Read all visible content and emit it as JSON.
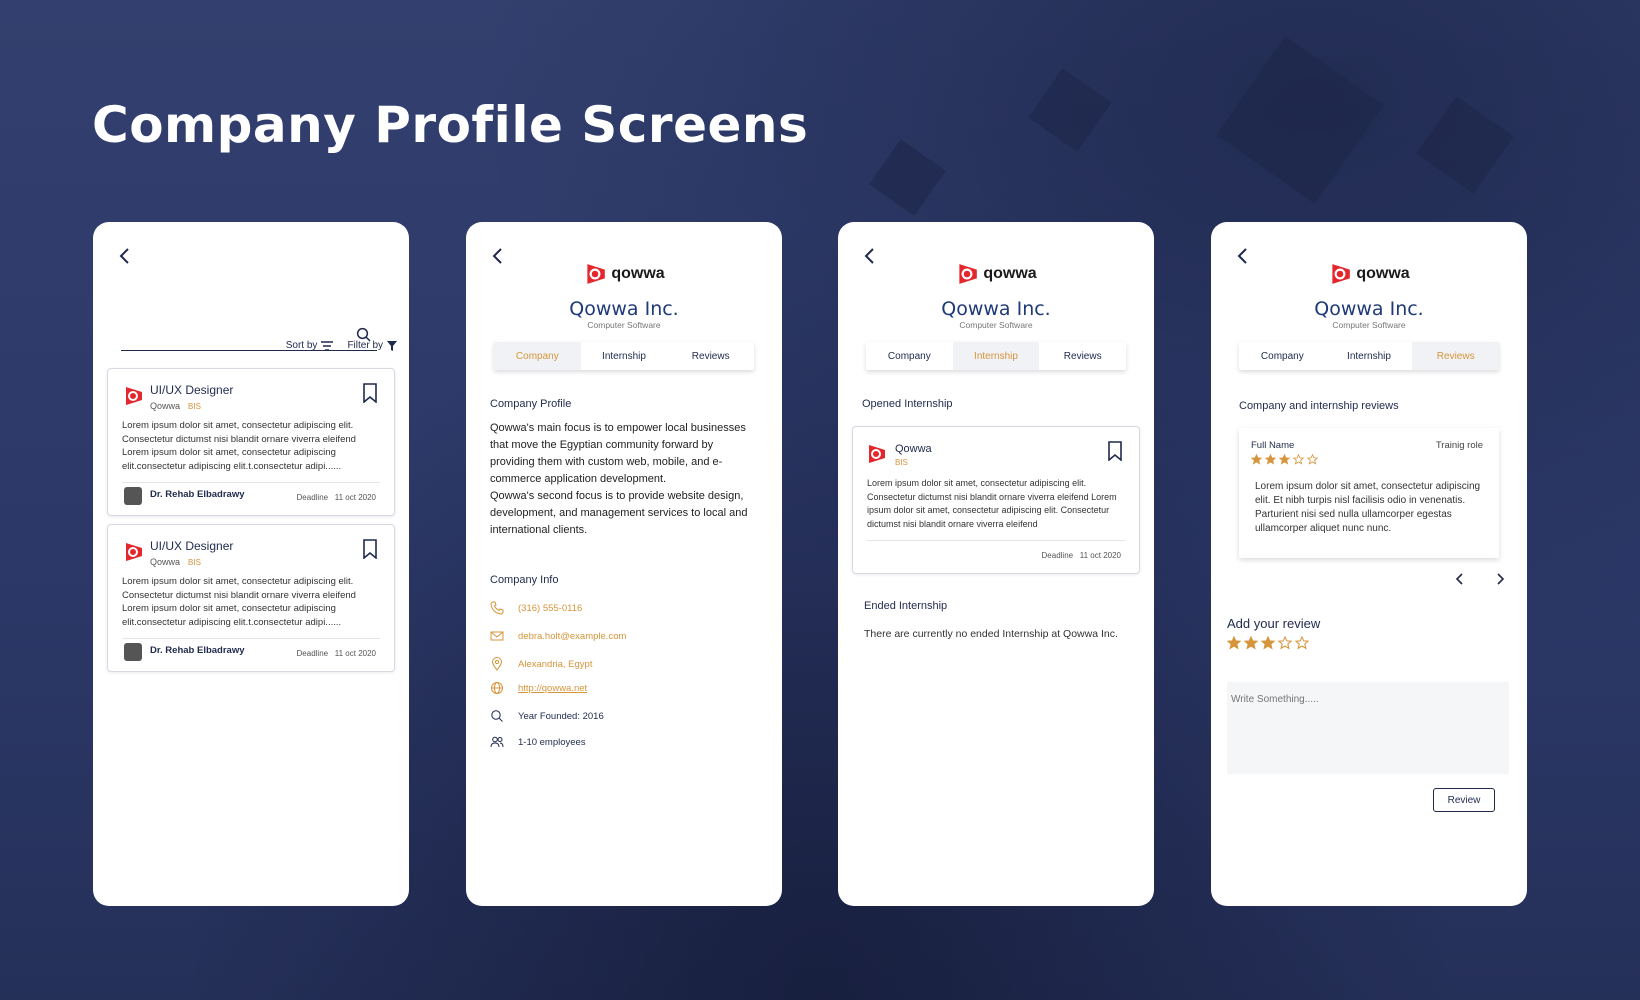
{
  "page_title": "Company Profile Screens",
  "colors": {
    "background": "#2d3a6b",
    "accent": "#d6953a",
    "navy": "#1f2a4d",
    "brand_red": "#e4262d",
    "title_blue": "#1f3a78"
  },
  "screen1": {
    "sort_label": "Sort by",
    "filter_label": "Filter by",
    "search_placeholder": "",
    "jobs": [
      {
        "title": "UI/UX Designer",
        "company": "Qowwa",
        "tag": "BIS",
        "description": "Lorem ipsum dolor sit amet, consectetur adipiscing elit. Consectetur dictumst nisi blandit ornare viverra eleifend Lorem ipsum dolor sit amet, consectetur adipiscing elit.consectetur adipiscing elit.t.consectetur adipi......",
        "poster": "Dr. Rehab Elbadrawy",
        "deadline_label": "Deadline",
        "deadline": "11 oct 2020"
      },
      {
        "title": "UI/UX Designer",
        "company": "Qowwa",
        "tag": "BIS",
        "description": "Lorem ipsum dolor sit amet, consectetur adipiscing elit. Consectetur dictumst nisi blandit ornare viverra eleifend Lorem ipsum dolor sit amet, consectetur adipiscing elit.consectetur adipiscing elit.t.consectetur adipi......",
        "poster": "Dr. Rehab Elbadrawy",
        "deadline_label": "Deadline",
        "deadline": "11 oct 2020"
      }
    ]
  },
  "company": {
    "brand_word": "qowwa",
    "name": "Qowwa Inc.",
    "category": "Computer Software",
    "tabs": [
      "Company",
      "Internship",
      "Reviews"
    ]
  },
  "screen2": {
    "profile_heading": "Company Profile",
    "profile_text": "Qowwa's main focus is to empower local businesses that move the Egyptian community forward by providing them with custom web, mobile, and e-commerce application development.\nQowwa's second focus is to provide website design, development, and management services to local and international clients.",
    "info_heading": "Company Info",
    "phone": "(316) 555-0116",
    "email": "debra.holt@example.com",
    "location": "Alexandria, Egypt",
    "website": "http://qowwa.net",
    "year_founded": "Year Founded: 2016",
    "employees": "1-10 employees"
  },
  "screen3": {
    "opened_heading": "Opened Internship",
    "card": {
      "company": "Qowwa",
      "tag": "BIS",
      "description": "Lorem ipsum dolor sit amet, consectetur adipiscing elit. Consectetur dictumst nisi blandit ornare viverra eleifend Lorem ipsum dolor sit amet, consectetur adipiscing elit. Consectetur dictumst nisi blandit ornare viverra eleifend",
      "deadline_label": "Deadline",
      "deadline": "11 oct 2020"
    },
    "ended_heading": "Ended Internship",
    "ended_text": "There are currently no ended Internship at Qowwa Inc."
  },
  "screen4": {
    "reviews_heading": "Company and internship reviews",
    "review": {
      "name": "Full Name",
      "role": "Trainig role",
      "rating": 3,
      "max_rating": 5,
      "text": "Lorem ipsum dolor sit amet, consectetur adipiscing elit. Et nibh turpis nisl facilisis odio in venenatis. Parturient nisi sed nulla ullamcorper egestas ullamcorper aliquet nunc nunc."
    },
    "add_review_heading": "Add your review",
    "add_rating": 3,
    "textarea_placeholder": "Write Something.....",
    "review_button": "Review"
  }
}
